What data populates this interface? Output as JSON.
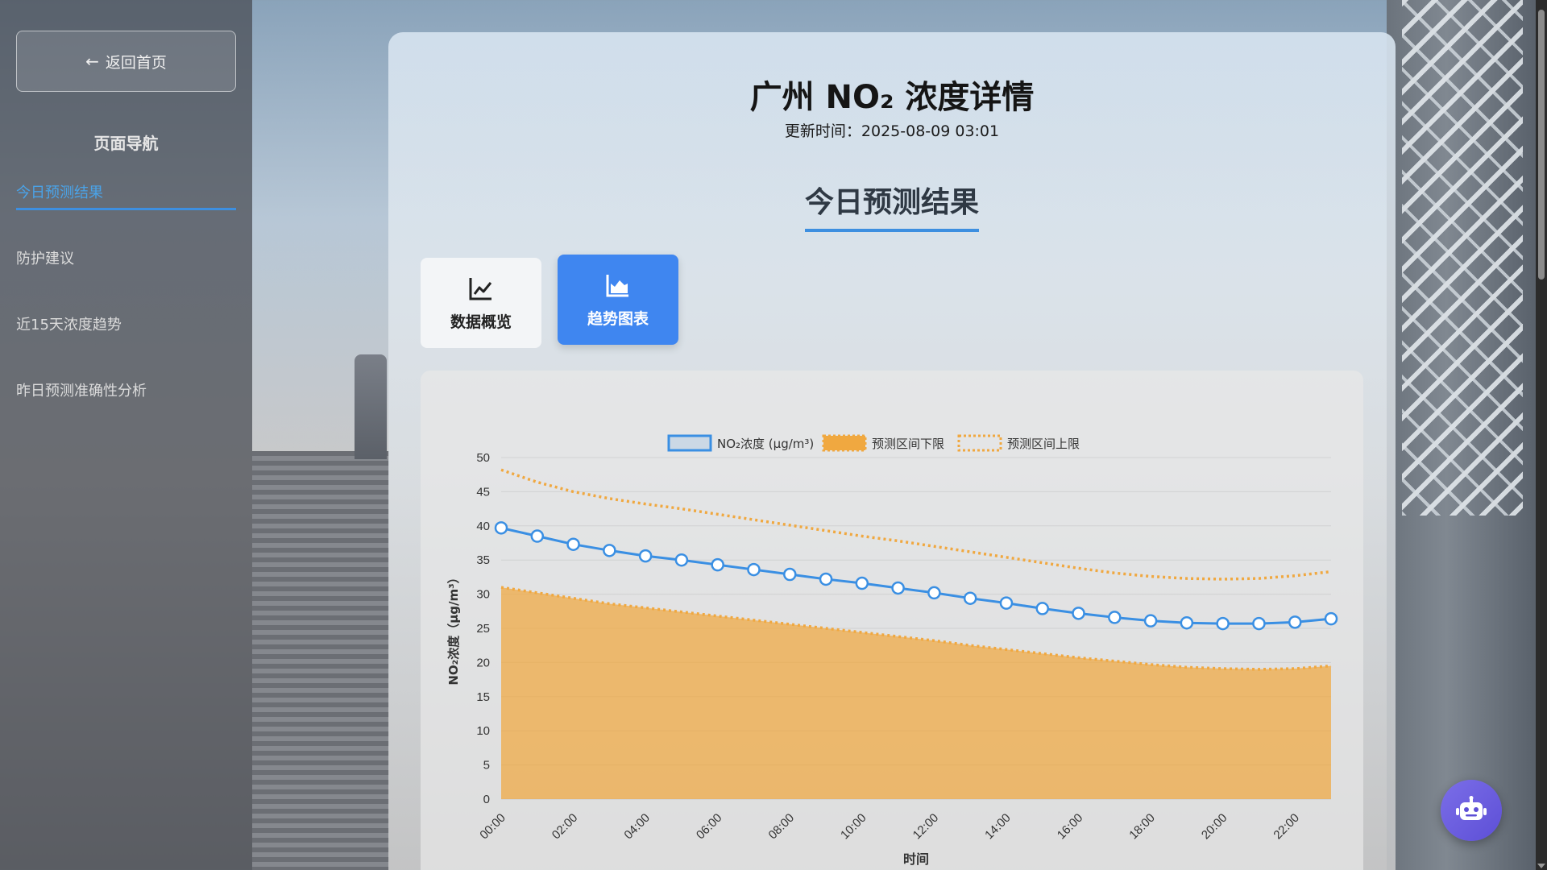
{
  "sidebar": {
    "back_label": "返回首页",
    "nav_title": "页面导航",
    "items": [
      {
        "label": "今日预测结果",
        "active": true
      },
      {
        "label": "防护建议",
        "active": false
      },
      {
        "label": "近15天浓度趋势",
        "active": false
      },
      {
        "label": "昨日预测准确性分析",
        "active": false
      }
    ]
  },
  "header": {
    "title": "广州 NO₂ 浓度详情",
    "update_label": "更新时间：",
    "update_time": "2025-08-09 03:01"
  },
  "section": {
    "title": "今日预测结果"
  },
  "tabs": [
    {
      "label": "数据概览",
      "icon": "line-chart-icon",
      "active": false
    },
    {
      "label": "趋势图表",
      "icon": "area-chart-icon",
      "active": true
    }
  ],
  "colors": {
    "accent": "#3f86f0",
    "series_line": "#3a8fe3",
    "band": "#f0a840"
  },
  "chart_data": {
    "type": "line",
    "xlabel": "时间",
    "ylabel": "NO₂浓度（μg/m³）",
    "ylim": [
      0,
      50
    ],
    "yticks": [
      0,
      5,
      10,
      15,
      20,
      25,
      30,
      35,
      40,
      45,
      50
    ],
    "x": [
      "00:00",
      "01:00",
      "02:00",
      "03:00",
      "04:00",
      "05:00",
      "06:00",
      "07:00",
      "08:00",
      "09:00",
      "10:00",
      "11:00",
      "12:00",
      "13:00",
      "14:00",
      "15:00",
      "16:00",
      "17:00",
      "18:00",
      "19:00",
      "20:00",
      "21:00",
      "22:00",
      "23:00"
    ],
    "xtick_labels": [
      "00:00",
      "02:00",
      "04:00",
      "06:00",
      "08:00",
      "10:00",
      "12:00",
      "14:00",
      "16:00",
      "18:00",
      "20:00",
      "22:00"
    ],
    "legend": "top",
    "grid": true,
    "series": [
      {
        "name": "NO₂浓度 (μg/m³)",
        "style": "line-markers",
        "values": [
          39.7,
          38.5,
          37.3,
          36.4,
          35.6,
          35.0,
          34.3,
          33.6,
          32.9,
          32.2,
          31.6,
          30.9,
          30.2,
          29.4,
          28.7,
          27.9,
          27.2,
          26.6,
          26.1,
          25.8,
          25.7,
          25.7,
          25.9,
          26.4
        ]
      },
      {
        "name": "预测区间下限",
        "style": "filled-dotted",
        "values": [
          31.0,
          30.2,
          29.4,
          28.6,
          28.0,
          27.4,
          26.8,
          26.2,
          25.6,
          25.0,
          24.4,
          23.8,
          23.2,
          22.5,
          21.9,
          21.3,
          20.7,
          20.2,
          19.7,
          19.3,
          19.1,
          19.0,
          19.1,
          19.5
        ]
      },
      {
        "name": "预测区间上限",
        "style": "dotted",
        "values": [
          48.2,
          46.4,
          45.0,
          44.0,
          43.2,
          42.5,
          41.7,
          40.9,
          40.1,
          39.3,
          38.5,
          37.8,
          37.0,
          36.2,
          35.4,
          34.6,
          33.8,
          33.1,
          32.6,
          32.3,
          32.2,
          32.3,
          32.7,
          33.3
        ]
      }
    ]
  }
}
